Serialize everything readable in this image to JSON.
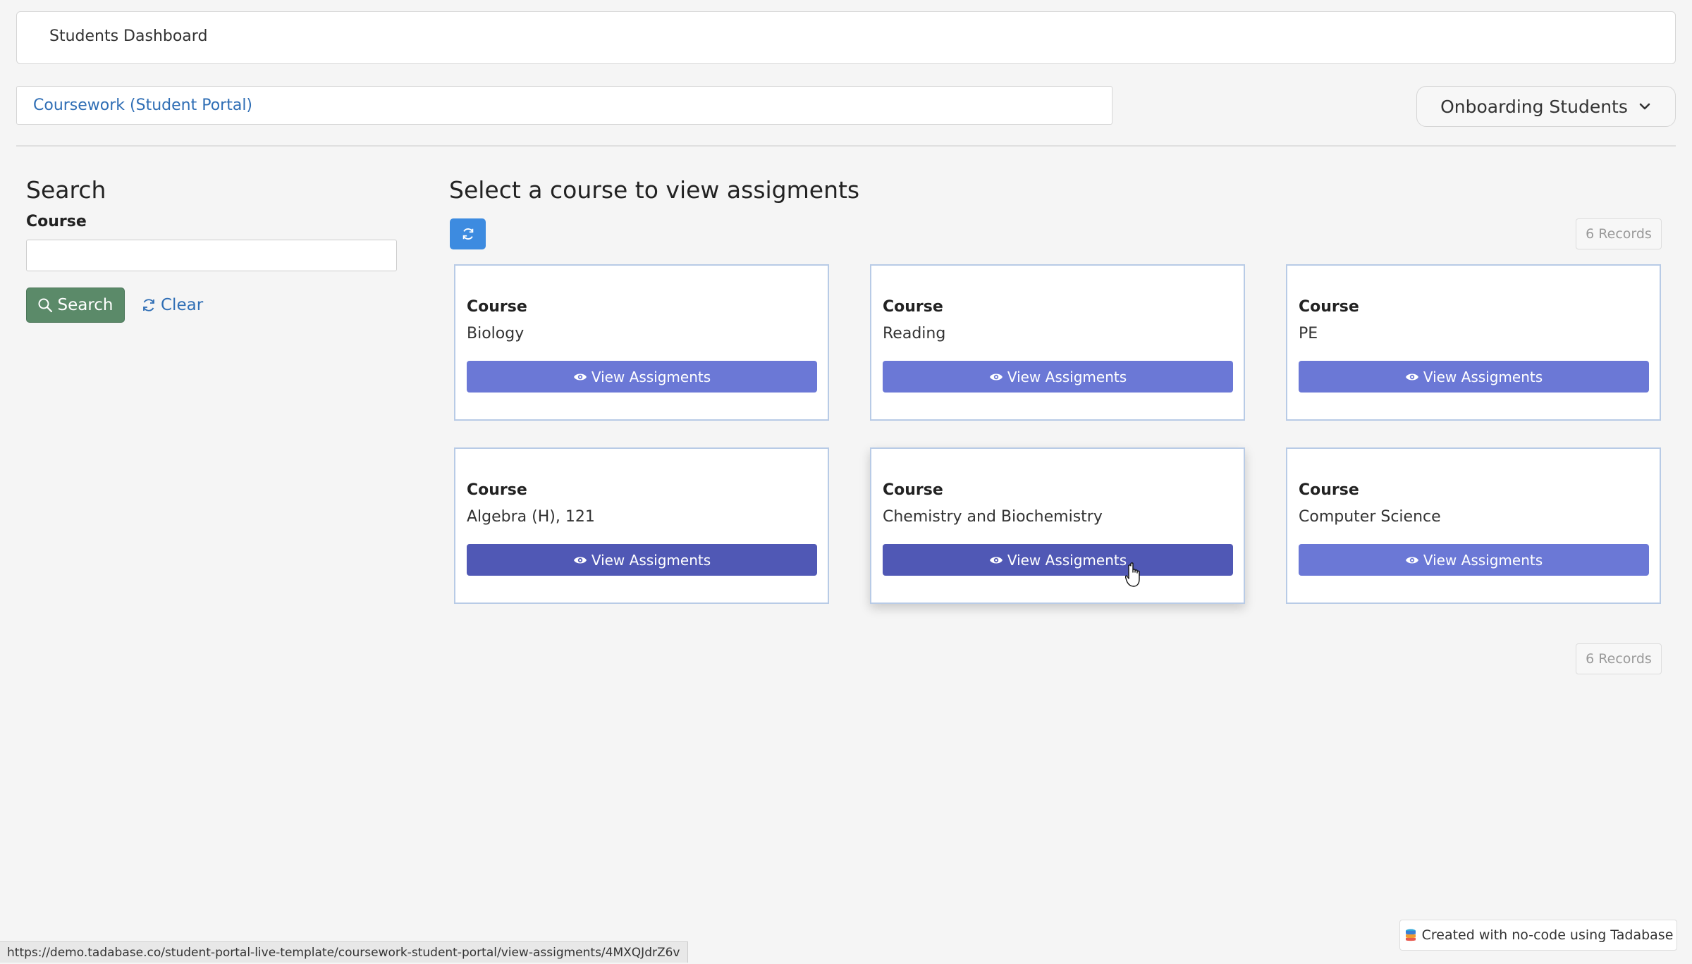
{
  "header": {
    "title": "Students Dashboard"
  },
  "nav": {
    "link_label": "Coursework (Student Portal)"
  },
  "role_dropdown": {
    "selected": "Onboarding Students"
  },
  "sidebar": {
    "title": "Search",
    "field_label": "Course",
    "input_value": "",
    "search_label": "Search",
    "clear_label": "Clear"
  },
  "main": {
    "title": "Select a course to view assigments",
    "records_top": "6 Records",
    "records_bottom": "6 Records",
    "cards": [
      {
        "label": "Course",
        "value": "Biology",
        "button": "View Assigments"
      },
      {
        "label": "Course",
        "value": "Reading",
        "button": "View Assigments"
      },
      {
        "label": "Course",
        "value": "PE",
        "button": "View Assigments"
      },
      {
        "label": "Course",
        "value": "Algebra (H), 121",
        "button": "View Assigments"
      },
      {
        "label": "Course",
        "value": "Chemistry and Biochemistry",
        "button": "View Assigments"
      },
      {
        "label": "Course",
        "value": "Computer Science",
        "button": "View Assigments"
      }
    ]
  },
  "status_bar": {
    "url": "https://demo.tadabase.co/student-portal-live-template/coursework-student-portal/view-assigments/4MXQJdrZ6v"
  },
  "footer_badge": {
    "text": "Created with no-code using Tadabase"
  },
  "colors": {
    "accent_blue": "#3d8be0",
    "search_green": "#5b8a69",
    "button_indigo": "#6b78d6",
    "button_indigo_hover": "#5058b5",
    "link_blue": "#2f6eb5"
  },
  "icons": {
    "search": "search-icon",
    "clear": "refresh-icon",
    "refresh": "refresh-icon",
    "view": "eye-icon",
    "dropdown": "chevron-down-icon",
    "badge": "database-icon"
  }
}
